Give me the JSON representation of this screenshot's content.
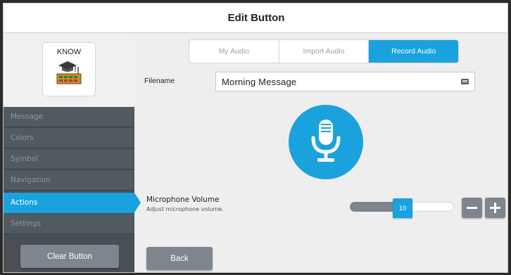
{
  "header": {
    "title": "Edit Button"
  },
  "preview": {
    "label": "KNOW",
    "symbol_icon": "graduation-cap-classroom-icon"
  },
  "sidebar": {
    "items": [
      {
        "label": "Message",
        "active": false
      },
      {
        "label": "Colors",
        "active": false
      },
      {
        "label": "Symbol",
        "active": false
      },
      {
        "label": "Navigation",
        "active": false
      },
      {
        "label": "Actions",
        "active": true
      },
      {
        "label": "Settings",
        "active": false
      }
    ],
    "clear_label": "Clear Button"
  },
  "tabs": [
    {
      "label": "My Audio",
      "active": false
    },
    {
      "label": "Import Audio",
      "active": false
    },
    {
      "label": "Record Audio",
      "active": true
    }
  ],
  "filename": {
    "label": "Filename",
    "value": "Morning Message",
    "icon": "keyboard-icon"
  },
  "record": {
    "icon": "microphone-icon"
  },
  "volume": {
    "title": "Microphone Volume",
    "description": "Adjust microphone volume.",
    "value": "10",
    "minus_icon": "minus-icon",
    "plus_icon": "plus-icon"
  },
  "footer": {
    "back_label": "Back"
  },
  "colors": {
    "accent": "#1aa2de",
    "sidebar": "#515961",
    "button": "#7d868e"
  }
}
